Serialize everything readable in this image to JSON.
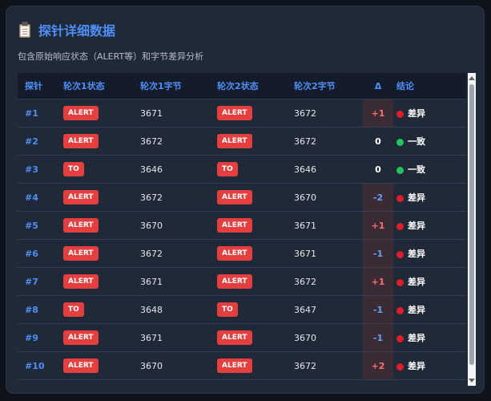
{
  "panel": {
    "title": "探针详细数据",
    "subtitle": "包含原始响应状态（ALERT等）和字节差异分析"
  },
  "table": {
    "headers": [
      "探针",
      "轮次1状态",
      "轮次1字节",
      "轮次2状态",
      "轮次2字节",
      "Δ",
      "结论"
    ],
    "rows": [
      {
        "id": "#1",
        "s1": "ALERT",
        "b1": "3671",
        "s2": "ALERT",
        "b2": "3672",
        "delta": "+1",
        "conclusion": "差异"
      },
      {
        "id": "#2",
        "s1": "ALERT",
        "b1": "3672",
        "s2": "ALERT",
        "b2": "3672",
        "delta": "0",
        "conclusion": "一致"
      },
      {
        "id": "#3",
        "s1": "TO",
        "b1": "3646",
        "s2": "TO",
        "b2": "3646",
        "delta": "0",
        "conclusion": "一致"
      },
      {
        "id": "#4",
        "s1": "ALERT",
        "b1": "3672",
        "s2": "ALERT",
        "b2": "3670",
        "delta": "-2",
        "conclusion": "差异"
      },
      {
        "id": "#5",
        "s1": "ALERT",
        "b1": "3670",
        "s2": "ALERT",
        "b2": "3671",
        "delta": "+1",
        "conclusion": "差异"
      },
      {
        "id": "#6",
        "s1": "ALERT",
        "b1": "3672",
        "s2": "ALERT",
        "b2": "3671",
        "delta": "-1",
        "conclusion": "差异"
      },
      {
        "id": "#7",
        "s1": "ALERT",
        "b1": "3671",
        "s2": "ALERT",
        "b2": "3672",
        "delta": "+1",
        "conclusion": "差异"
      },
      {
        "id": "#8",
        "s1": "TO",
        "b1": "3648",
        "s2": "TO",
        "b2": "3647",
        "delta": "-1",
        "conclusion": "差异"
      },
      {
        "id": "#9",
        "s1": "ALERT",
        "b1": "3671",
        "s2": "ALERT",
        "b2": "3670",
        "delta": "-1",
        "conclusion": "差异"
      },
      {
        "id": "#10",
        "s1": "ALERT",
        "b1": "3670",
        "s2": "ALERT",
        "b2": "3672",
        "delta": "+2",
        "conclusion": "差异"
      }
    ]
  },
  "colors": {
    "accent": "#4f8ff7",
    "alert_badge": "#e53e3e",
    "diff_dot": "#e11d2a",
    "same_dot": "#22c55e"
  },
  "icons": {
    "title_icon": "clipboard-icon",
    "diff_icon": "red-dot-icon",
    "same_icon": "green-dot-icon"
  }
}
